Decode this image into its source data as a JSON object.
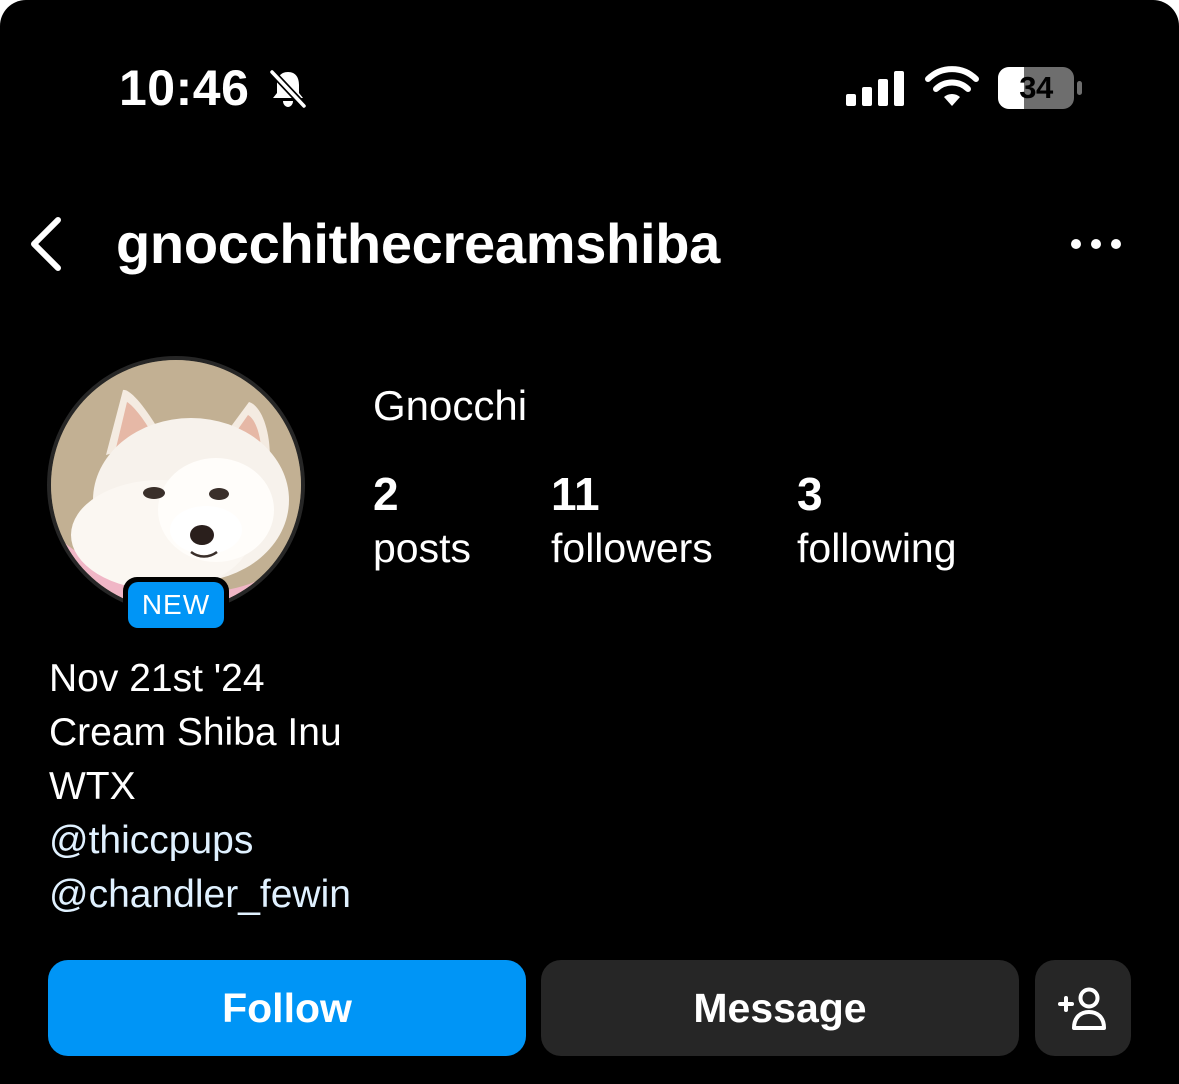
{
  "status_bar": {
    "time": "10:46",
    "battery": "34",
    "icons": [
      "bell-off-icon",
      "signal-icon",
      "wifi-icon",
      "battery-icon"
    ]
  },
  "header": {
    "back_icon": "chevron-left-icon",
    "username": "gnocchithecreamshiba",
    "more_icon": "ellipsis-icon"
  },
  "profile": {
    "avatar": "profile-photo-cream-shiba",
    "new_badge": "NEW",
    "display_name": "Gnocchi",
    "stats": [
      {
        "count": "2",
        "label": "posts"
      },
      {
        "count": "11",
        "label": "followers"
      },
      {
        "count": "3",
        "label": "following"
      }
    ],
    "bio": {
      "lines": [
        "Nov 21st '24",
        "Cream Shiba Inu",
        "WTX"
      ],
      "mentions": [
        "@thiccpups",
        "@chandler_fewin"
      ]
    }
  },
  "actions": {
    "follow_label": "Follow",
    "message_label": "Message",
    "add_user_icon": "add-person-icon"
  },
  "colors": {
    "background": "#000000",
    "primary_button": "#0095f6",
    "secondary_button": "#262626",
    "mention_text": "#e0f1ff"
  }
}
